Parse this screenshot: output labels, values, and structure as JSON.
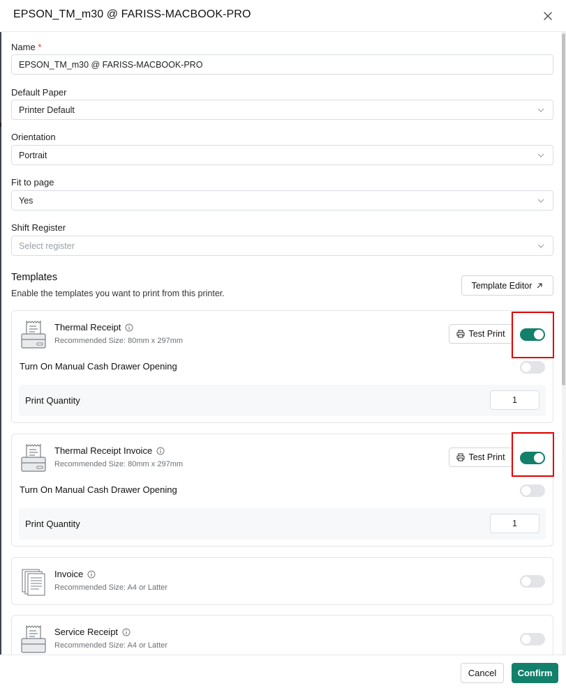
{
  "header": {
    "title": "EPSON_TM_m30 @ FARISS-MACBOOK-PRO",
    "close_icon": "close-icon"
  },
  "form": {
    "name": {
      "label": "Name",
      "required_mark": "*",
      "value": "EPSON_TM_m30 @ FARISS-MACBOOK-PRO"
    },
    "default_paper": {
      "label": "Default Paper",
      "value": "Printer Default"
    },
    "orientation": {
      "label": "Orientation",
      "value": "Portrait"
    },
    "fit_to_page": {
      "label": "Fit to page",
      "value": "Yes"
    },
    "shift_register": {
      "label": "Shift Register",
      "placeholder": "Select register"
    }
  },
  "templates": {
    "title": "Templates",
    "description": "Enable the templates you want to print from this printer.",
    "editor_button": "Template Editor",
    "test_print_label": "Test Print",
    "drawer_label": "Turn On Manual Cash Drawer Opening",
    "quantity_label": "Print Quantity",
    "items": [
      {
        "name": "Thermal Receipt",
        "recommended": "Recommended Size: 80mm x 297mm",
        "enabled": true,
        "icon": "receipt-printer-icon",
        "quantity": "1",
        "drawer_enabled": false
      },
      {
        "name": "Thermal Receipt Invoice",
        "recommended": "Recommended Size: 80mm x 297mm",
        "enabled": true,
        "icon": "receipt-printer-icon",
        "quantity": "1",
        "drawer_enabled": false
      },
      {
        "name": "Invoice",
        "recommended": "Recommended Size: A4 or Latter",
        "enabled": false,
        "icon": "document-stack-icon"
      },
      {
        "name": "Service Receipt",
        "recommended": "Recommended Size: A4 or Latter",
        "enabled": false,
        "icon": "receipt-printer-icon"
      }
    ]
  },
  "footer": {
    "cancel": "Cancel",
    "confirm": "Confirm"
  },
  "colors": {
    "accent": "#13806b",
    "highlight": "#e00000"
  }
}
